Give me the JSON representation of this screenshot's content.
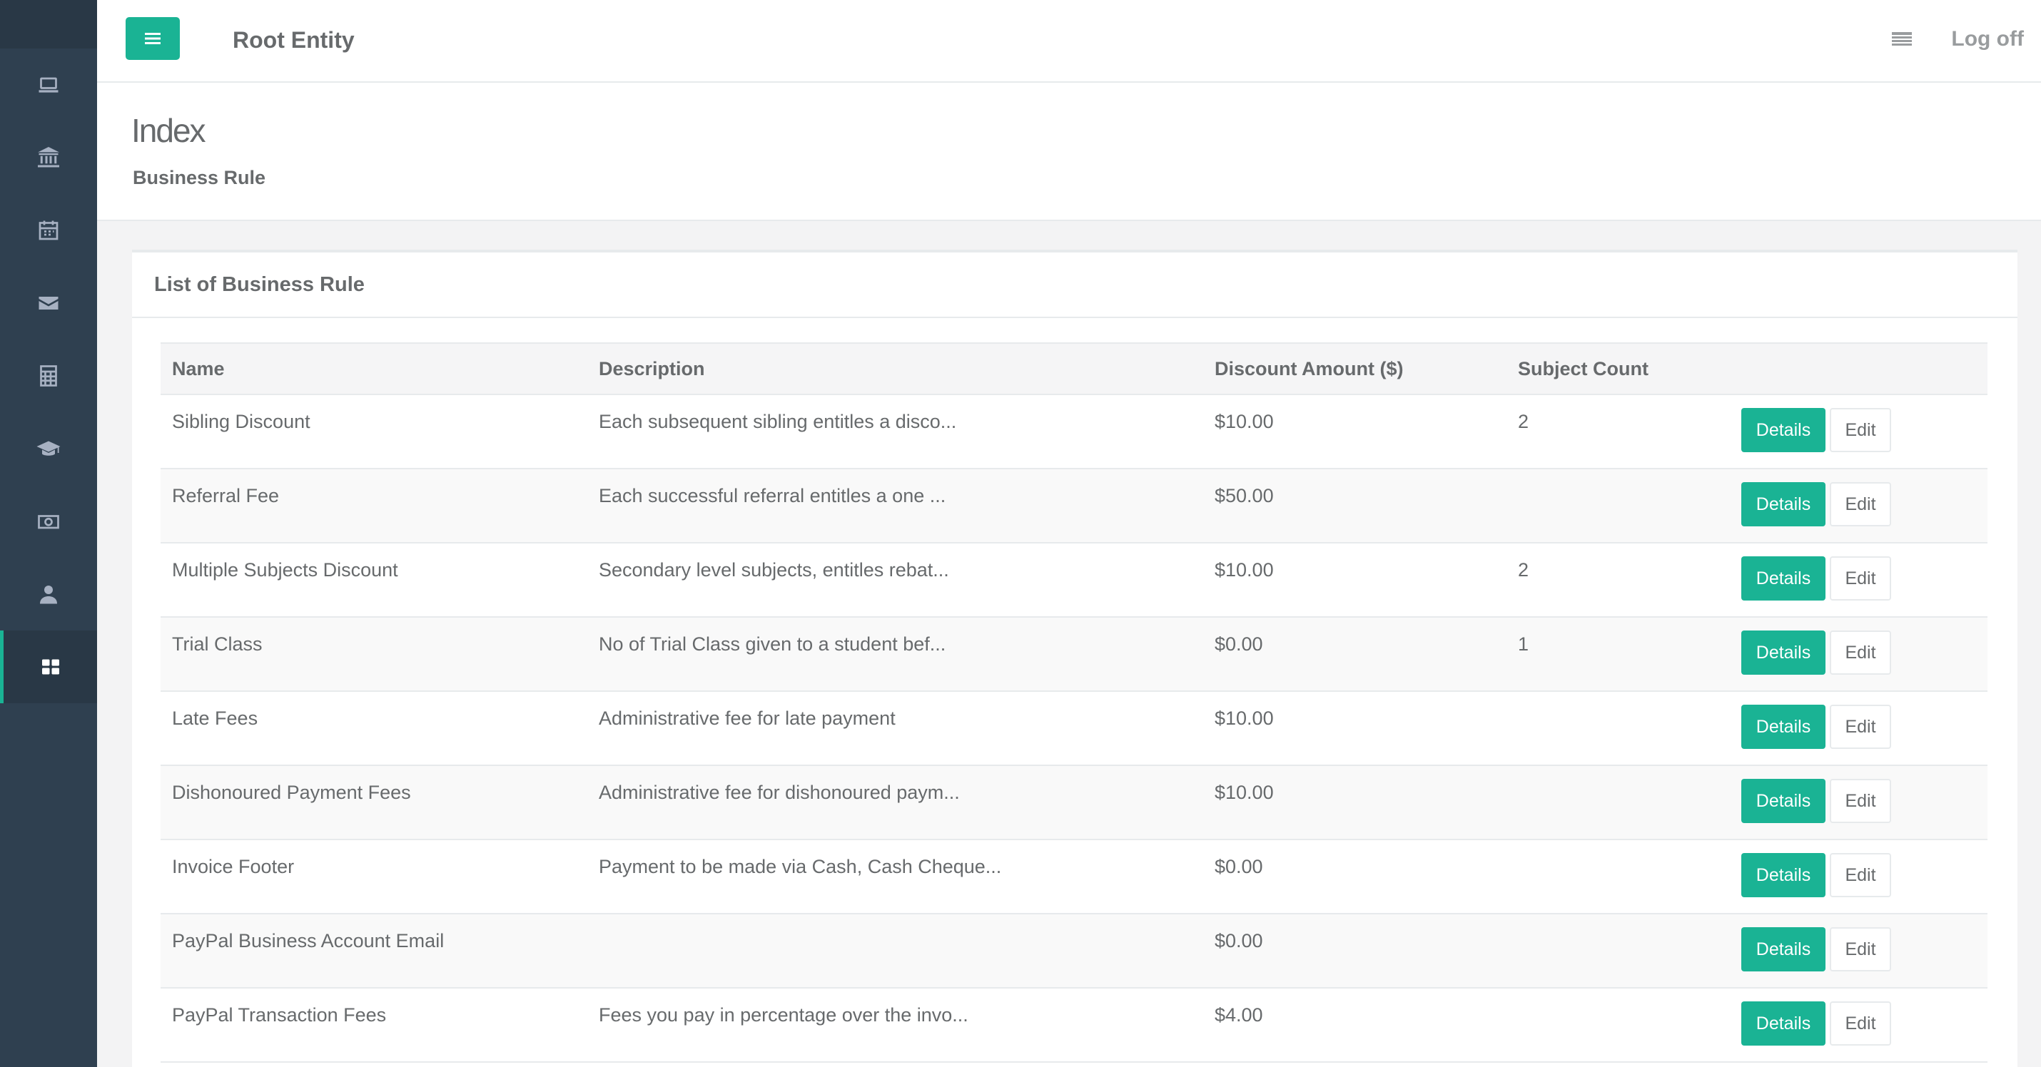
{
  "header": {
    "entity_title": "Root Entity",
    "logoff_label": "Log off"
  },
  "sidebar": {
    "items": [
      {
        "icon": "laptop-icon",
        "active": false
      },
      {
        "icon": "bank-icon",
        "active": false
      },
      {
        "icon": "calendar-icon",
        "active": false
      },
      {
        "icon": "envelope-icon",
        "active": false
      },
      {
        "icon": "calculator-icon",
        "active": false
      },
      {
        "icon": "graduation-cap-icon",
        "active": false
      },
      {
        "icon": "money-icon",
        "active": false
      },
      {
        "icon": "user-icon",
        "active": false
      },
      {
        "icon": "grid-icon",
        "active": true
      }
    ]
  },
  "page": {
    "title": "Index",
    "breadcrumb": "Business Rule"
  },
  "panel": {
    "title": "List of Business Rule"
  },
  "table": {
    "columns": [
      "Name",
      "Description",
      "Discount Amount ($)",
      "Subject Count",
      ""
    ],
    "details_label": "Details",
    "edit_label": "Edit",
    "rows": [
      {
        "name": "Sibling Discount",
        "description": "Each subsequent sibling entitles a disco...",
        "amount": "$10.00",
        "count": "2"
      },
      {
        "name": "Referral Fee",
        "description": "Each successful referral entitles a one ...",
        "amount": "$50.00",
        "count": ""
      },
      {
        "name": "Multiple Subjects Discount",
        "description": "Secondary level subjects, entitles rebat...",
        "amount": "$10.00",
        "count": "2"
      },
      {
        "name": "Trial Class",
        "description": "No of Trial Class given to a student bef...",
        "amount": "$0.00",
        "count": "1"
      },
      {
        "name": "Late Fees",
        "description": "Administrative fee for late payment",
        "amount": "$10.00",
        "count": ""
      },
      {
        "name": "Dishonoured Payment Fees",
        "description": "Administrative fee for dishonoured paym...",
        "amount": "$10.00",
        "count": ""
      },
      {
        "name": "Invoice Footer",
        "description": "Payment to be made via Cash, Cash Cheque...",
        "amount": "$0.00",
        "count": ""
      },
      {
        "name": "PayPal Business Account Email",
        "description": "",
        "amount": "$0.00",
        "count": ""
      },
      {
        "name": "PayPal Transaction Fees",
        "description": "Fees you pay in percentage over the invo...",
        "amount": "$4.00",
        "count": ""
      }
    ]
  },
  "colors": {
    "accent": "#1ab394",
    "sidebar": "#2f4050",
    "sidebar_dark": "#293846"
  }
}
